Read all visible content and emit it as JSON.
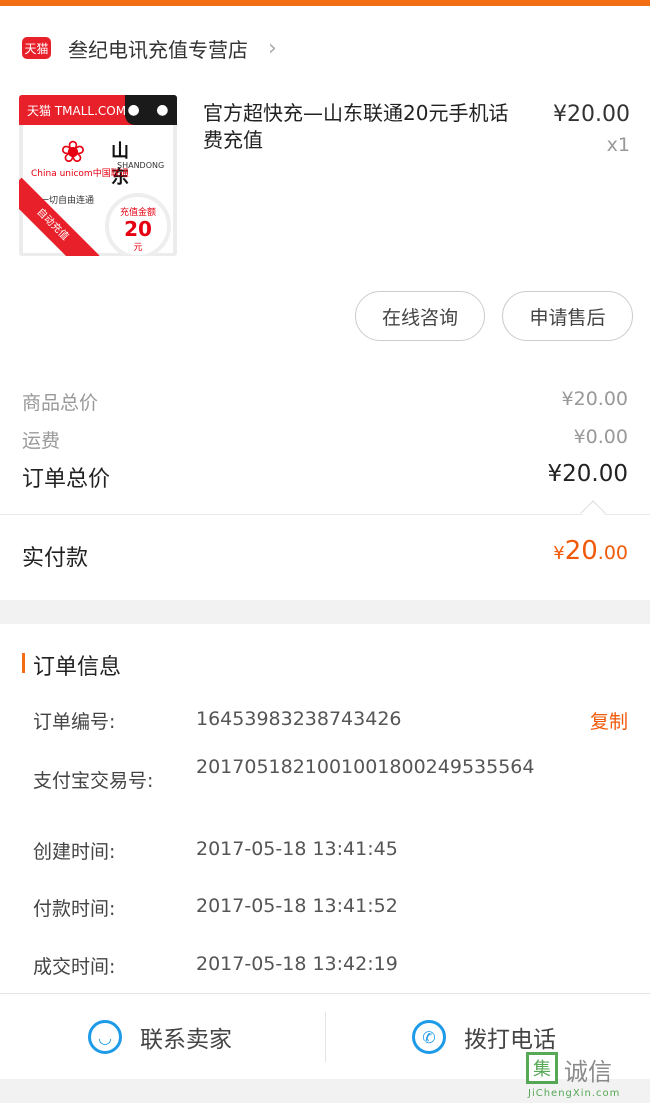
{
  "colors": {
    "accent": "#f36d12",
    "price_accent": "#f05a0a",
    "link_blue": "#1e9be8",
    "tmall_red": "#e8202a"
  },
  "shop": {
    "badge": "天猫",
    "name": "叁纪电讯充值专营店",
    "chevron": "›"
  },
  "product": {
    "image": {
      "brand_text": "天猫 TMALL.COM",
      "province": "山 东",
      "province_en": "SHANDONG",
      "carrier": "China unicom中国联通",
      "slogan": "让一切自由连通",
      "amount_caption": "充值金额",
      "amount": "20",
      "amount_unit": "元",
      "ribbon": "自动充值"
    },
    "title": "官方超快充—山东联通20元手机话费充值",
    "price": "¥20.00",
    "quantity": "x1"
  },
  "actions": {
    "consult": "在线咨询",
    "after_sale": "申请售后"
  },
  "summary": {
    "goods_total_label": "商品总价",
    "goods_total": "¥20.00",
    "shipping_label": "运费",
    "shipping": "¥0.00",
    "order_total_label": "订单总价",
    "order_total": "¥20.00",
    "paid_label": "实付款",
    "paid_currency": "¥",
    "paid_int": "20",
    "paid_dec": ".00"
  },
  "order_info": {
    "title": "订单信息",
    "copy": "复制",
    "rows": [
      {
        "label": "订单编号:",
        "value": "16453983238743426"
      },
      {
        "label": "支付宝交易号:",
        "value": "2017051821001001800249535564"
      },
      {
        "label": "创建时间:",
        "value": "2017-05-18 13:41:45"
      },
      {
        "label": "付款时间:",
        "value": "2017-05-18 13:41:52"
      },
      {
        "label": "成交时间:",
        "value": "2017-05-18 13:42:19"
      }
    ]
  },
  "bottom": {
    "contact_seller": "联系卖家",
    "call": "拨打电话"
  },
  "watermark": {
    "glyph": "集",
    "text": "诚信",
    "en": "JiChengXin.com"
  }
}
